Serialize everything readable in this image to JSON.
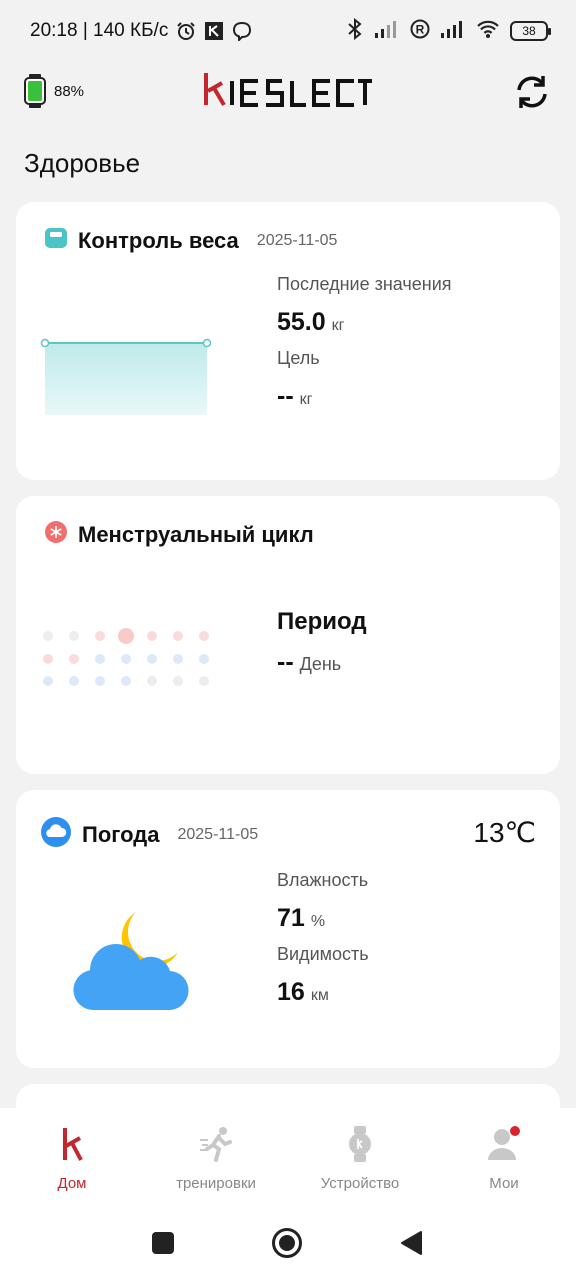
{
  "status_bar": {
    "time_speed": "20:18 | 140 КБ/с",
    "battery": "38",
    "icons": [
      "alarm-icon",
      "app-icon",
      "viber-icon",
      "bluetooth-icon",
      "signal-icon",
      "roaming-icon",
      "signal-icon",
      "wifi-icon",
      "battery-icon"
    ]
  },
  "header": {
    "watch_battery": "88%",
    "brand": "KIESLECT",
    "brand_color": "#c4262e",
    "watch_battery_color": "#38c13a"
  },
  "section_title": "Здоровье",
  "weight_card": {
    "title": "Контроль веса",
    "date": "2025-11-05",
    "last_label": "Последние значения",
    "last_value": "55.0",
    "last_unit": "кг",
    "goal_label": "Цель",
    "goal_value": "--",
    "goal_unit": "кг"
  },
  "menstrual_card": {
    "title": "Менструальный цикл",
    "period_label": "Период",
    "period_value": "--",
    "period_unit": "День"
  },
  "weather_card": {
    "title": "Погода",
    "date": "2025-11-05",
    "temperature": "13℃",
    "humidity_label": "Влажность",
    "humidity_value": "71",
    "humidity_unit": "%",
    "visibility_label": "Видимость",
    "visibility_value": "16",
    "visibility_unit": "км"
  },
  "nav": {
    "items": [
      {
        "label": "Дом",
        "icon": "home-k-icon",
        "active": true
      },
      {
        "label": "тренировки",
        "icon": "running-icon",
        "active": false
      },
      {
        "label": "Устройство",
        "icon": "watch-icon",
        "active": false
      },
      {
        "label": "Мои",
        "icon": "profile-icon",
        "active": false
      }
    ]
  },
  "system_nav": [
    "recents-button",
    "home-button",
    "back-button"
  ]
}
